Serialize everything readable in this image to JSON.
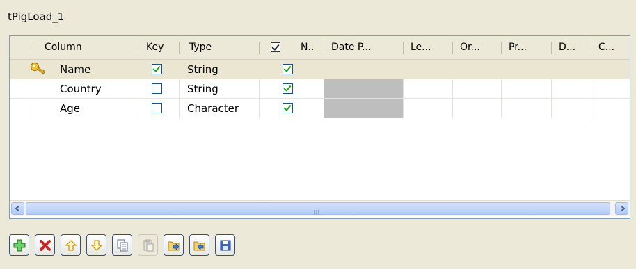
{
  "component_title": "tPigLoad_1",
  "table": {
    "headers": {
      "column": "Column",
      "key": "Key",
      "type": "Type",
      "nullable": "N..",
      "date_pattern": "Date P...",
      "length": "Le...",
      "original_length": "Or...",
      "precision": "Pr...",
      "default": "D...",
      "comment": "C..."
    },
    "rows": [
      {
        "column": "Name",
        "key": true,
        "type": "String",
        "nullable": true,
        "primary_key_icon": "key-icon"
      },
      {
        "column": "Country",
        "key": false,
        "type": "String",
        "nullable": true
      },
      {
        "column": "Age",
        "key": false,
        "type": "Character",
        "nullable": true
      }
    ]
  },
  "scrollbar": {
    "left_arrow": "◀",
    "right_arrow": "▶"
  },
  "toolbar": {
    "buttons": [
      {
        "name": "add",
        "icon": "plus-icon",
        "enabled": true
      },
      {
        "name": "remove",
        "icon": "delete-x-icon",
        "enabled": true
      },
      {
        "name": "move-up",
        "icon": "arrow-up-icon",
        "enabled": true
      },
      {
        "name": "move-down",
        "icon": "arrow-down-icon",
        "enabled": true
      },
      {
        "name": "copy",
        "icon": "copy-icon",
        "enabled": true
      },
      {
        "name": "paste",
        "icon": "paste-icon",
        "enabled": false
      },
      {
        "name": "import",
        "icon": "import-icon",
        "enabled": true
      },
      {
        "name": "export",
        "icon": "export-icon",
        "enabled": true
      },
      {
        "name": "save",
        "icon": "save-icon",
        "enabled": true
      }
    ]
  },
  "colors": {
    "background": "#ECE9D8",
    "check_green": "#21A121",
    "border_blue": "#2D4F8E"
  }
}
